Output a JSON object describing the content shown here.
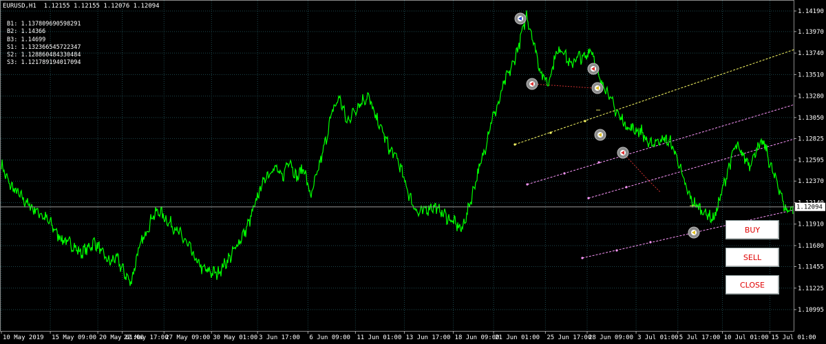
{
  "header": {
    "symbol_timeframe": "EURUSD,H1",
    "ohlc": "1.12155 1.12155 1.12076 1.12094"
  },
  "levels": [
    "B1: 1.137809690598291",
    "B2: 1.14366",
    "B3: 1.14699",
    "S1: 1.132366545722347",
    "S2: 1.128860484330484",
    "S3: 1.121789194017094"
  ],
  "buttons": {
    "buy": "BUY",
    "sell": "SELL",
    "close": "CLOSE"
  },
  "colors": {
    "price_line": "#00ff00",
    "grid": "#1e4a50",
    "channel_1": "#ffff66",
    "channel_2": "#ff99ff",
    "button_text": "#e00000",
    "current_price_bg": "#ffffff"
  },
  "chart_data": {
    "type": "line",
    "symbol": "EURUSD",
    "timeframe": "H1",
    "current_price": 1.12094,
    "price_labels": [
      "1.14190",
      "1.13970",
      "1.13740",
      "1.13510",
      "1.13280",
      "1.13050",
      "1.12825",
      "1.12595",
      "1.12370",
      "1.12140",
      "1.11910",
      "1.11680",
      "1.11455",
      "1.11225",
      "1.10995"
    ],
    "price_ticks": [
      1.1419,
      1.1397,
      1.1374,
      1.1351,
      1.1328,
      1.1305,
      1.12825,
      1.12595,
      1.1237,
      1.1214,
      1.1191,
      1.1168,
      1.11455,
      1.11225,
      1.10995
    ],
    "ylim": [
      1.10995,
      1.1419
    ],
    "time_labels": [
      "10 May 2019",
      "15 May 09:00",
      "20 May 01:00",
      "22 May 17:00",
      "27 May 09:00",
      "30 May 01:00",
      "3 Jun 17:00",
      "6 Jun 09:00",
      "11 Jun 01:00",
      "13 Jun 17:00",
      "18 Jun 09:00",
      "21 Jun 01:00",
      "25 Jun 17:00",
      "28 Jun 09:00",
      "3 Jul 01:00",
      "5 Jul 17:00",
      "10 Jul 01:00",
      "15 Jul 01:00"
    ],
    "time_index": [
      0,
      3.4,
      6.7,
      8.4,
      11.3,
      14.6,
      17.8,
      21.3,
      24.6,
      28.0,
      31.4,
      34.2,
      37.8,
      40.7,
      44.1,
      47.0,
      50.1,
      53.4
    ],
    "series": [
      {
        "x": [
          0,
          0.5,
          1,
          1.5,
          2,
          2.5,
          3,
          3.5,
          4,
          4.5,
          5,
          5.5,
          6,
          6.5,
          7,
          7.5,
          8,
          8.5,
          9,
          9.5,
          10,
          10.5,
          11,
          11.5,
          12,
          12.5,
          13,
          13.5,
          14,
          14.5,
          15,
          15.5,
          16,
          16.5,
          17,
          17.5,
          18,
          18.5,
          19,
          19.5,
          20,
          20.5,
          21,
          21.5,
          22,
          22.5,
          23,
          23.5,
          24,
          24.5,
          25,
          25.5,
          26,
          26.5,
          27,
          27.5,
          28,
          28.5,
          29,
          29.5,
          30,
          30.5,
          31,
          31.5,
          32,
          32.5,
          33,
          33.5,
          34,
          34.5,
          35,
          35.5,
          36,
          36.5,
          37,
          37.5,
          38,
          38.5,
          39,
          39.5,
          40,
          40.5,
          41,
          41.5,
          42,
          42.5,
          43,
          43.5,
          44,
          44.5,
          45,
          45.5,
          46,
          46.5,
          47,
          47.5,
          48,
          48.5,
          49,
          49.5,
          50,
          50.5,
          51,
          51.5,
          52,
          52.5,
          53,
          53.5,
          54,
          54.5,
          55
        ],
        "y": [
          1.1255,
          1.1235,
          1.1226,
          1.1218,
          1.121,
          1.1205,
          1.1198,
          1.119,
          1.1178,
          1.1172,
          1.1168,
          1.116,
          1.1165,
          1.1172,
          1.116,
          1.115,
          1.1155,
          1.114,
          1.1128,
          1.1162,
          1.118,
          1.12,
          1.1205,
          1.1195,
          1.1188,
          1.1178,
          1.1168,
          1.1152,
          1.1143,
          1.114,
          1.1138,
          1.1148,
          1.1158,
          1.1172,
          1.1185,
          1.1205,
          1.123,
          1.1245,
          1.1252,
          1.124,
          1.1262,
          1.124,
          1.1252,
          1.122,
          1.1248,
          1.1278,
          1.1312,
          1.1327,
          1.13,
          1.1312,
          1.1322,
          1.1328,
          1.1305,
          1.129,
          1.127,
          1.1262,
          1.1238,
          1.1215,
          1.1202,
          1.1207,
          1.121,
          1.1205,
          1.1198,
          1.1192,
          1.1185,
          1.121,
          1.124,
          1.1265,
          1.13,
          1.1318,
          1.1345,
          1.136,
          1.1385,
          1.1415,
          1.1385,
          1.1352,
          1.1342,
          1.1372,
          1.138,
          1.136,
          1.137,
          1.1368,
          1.138,
          1.1345,
          1.1338,
          1.1318,
          1.1305,
          1.1295,
          1.1292,
          1.129,
          1.1275,
          1.128,
          1.1282,
          1.1278,
          1.126,
          1.1232,
          1.1215,
          1.1208,
          1.1202,
          1.1196,
          1.1222,
          1.125,
          1.1275,
          1.1265,
          1.1255,
          1.1272,
          1.1278,
          1.125,
          1.1232,
          1.1205,
          1.1209
        ]
      }
    ]
  }
}
